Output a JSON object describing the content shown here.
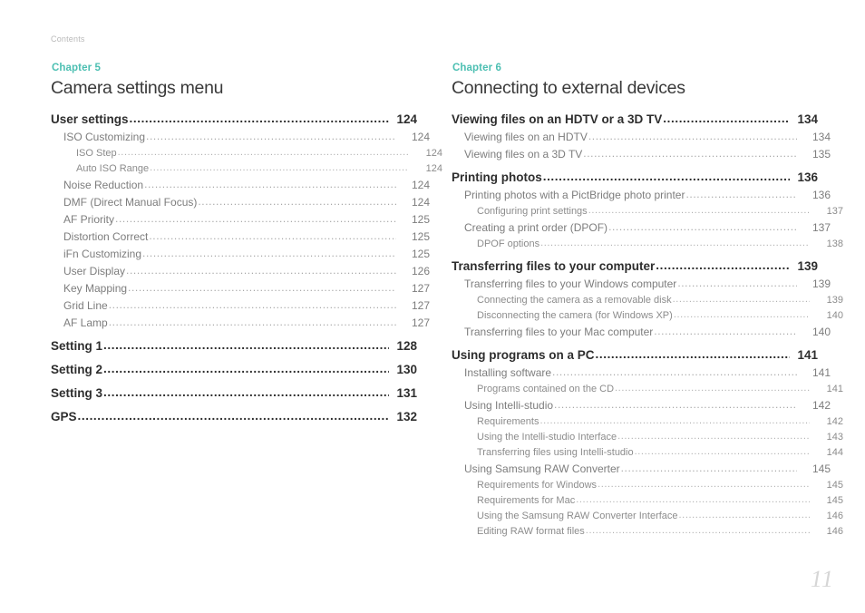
{
  "running_head": "Contents",
  "folio": "11",
  "accent_color": "#4cbfb2",
  "columns": [
    {
      "chapter_label": "Chapter 5",
      "chapter_title": "Camera settings menu",
      "entries": [
        {
          "level": 1,
          "label": "User settings",
          "page": "124"
        },
        {
          "level": 2,
          "label": "ISO Customizing",
          "page": "124"
        },
        {
          "level": 3,
          "label": "ISO Step",
          "page": "124"
        },
        {
          "level": 3,
          "label": "Auto ISO Range",
          "page": "124"
        },
        {
          "level": 2,
          "label": "Noise Reduction",
          "page": "124"
        },
        {
          "level": 2,
          "label": "DMF (Direct Manual Focus)",
          "page": "124"
        },
        {
          "level": 2,
          "label": "AF Priority",
          "page": "125"
        },
        {
          "level": 2,
          "label": "Distortion Correct",
          "page": "125"
        },
        {
          "level": 2,
          "label": "iFn Customizing",
          "page": "125"
        },
        {
          "level": 2,
          "label": "User Display",
          "page": "126"
        },
        {
          "level": 2,
          "label": "Key Mapping",
          "page": "127"
        },
        {
          "level": 2,
          "label": "Grid Line",
          "page": "127"
        },
        {
          "level": 2,
          "label": "AF Lamp",
          "page": "127"
        },
        {
          "level": 1,
          "label": "Setting 1",
          "page": "128"
        },
        {
          "level": 1,
          "label": "Setting 2",
          "page": "130"
        },
        {
          "level": 1,
          "label": "Setting 3",
          "page": "131"
        },
        {
          "level": 1,
          "label": "GPS",
          "page": "132"
        }
      ]
    },
    {
      "chapter_label": "Chapter 6",
      "chapter_title": "Connecting to external devices",
      "entries": [
        {
          "level": 1,
          "label": "Viewing files on an HDTV or a 3D TV",
          "page": "134"
        },
        {
          "level": 2,
          "label": "Viewing files on an HDTV",
          "page": "134"
        },
        {
          "level": 2,
          "label": "Viewing files on a 3D TV",
          "page": "135"
        },
        {
          "level": 1,
          "label": "Printing photos",
          "page": "136"
        },
        {
          "level": 2,
          "label": "Printing photos with a PictBridge photo printer",
          "page": "136"
        },
        {
          "level": 3,
          "label": "Configuring print settings",
          "page": "137"
        },
        {
          "level": 2,
          "label": "Creating a print order (DPOF)",
          "page": "137"
        },
        {
          "level": 3,
          "label": "DPOF options",
          "page": "138"
        },
        {
          "level": 1,
          "label": "Transferring files to your computer",
          "page": "139"
        },
        {
          "level": 2,
          "label": "Transferring files to your Windows computer",
          "page": "139"
        },
        {
          "level": 3,
          "label": "Connecting the camera as a removable disk",
          "page": "139"
        },
        {
          "level": 3,
          "label": "Disconnecting the camera (for Windows XP)",
          "page": "140"
        },
        {
          "level": 2,
          "label": "Transferring files to your Mac computer",
          "page": "140"
        },
        {
          "level": 1,
          "label": "Using programs on a PC",
          "page": "141"
        },
        {
          "level": 2,
          "label": "Installing software",
          "page": "141"
        },
        {
          "level": 3,
          "label": "Programs contained on the CD",
          "page": "141"
        },
        {
          "level": 2,
          "label": "Using Intelli-studio",
          "page": "142"
        },
        {
          "level": 3,
          "label": "Requirements",
          "page": "142"
        },
        {
          "level": 3,
          "label": "Using the Intelli-studio Interface",
          "page": "143"
        },
        {
          "level": 3,
          "label": "Transferring files using Intelli-studio",
          "page": "144"
        },
        {
          "level": 2,
          "label": "Using Samsung RAW Converter",
          "page": "145"
        },
        {
          "level": 3,
          "label": "Requirements for Windows",
          "page": "145"
        },
        {
          "level": 3,
          "label": "Requirements for Mac",
          "page": "145"
        },
        {
          "level": 3,
          "label": "Using the Samsung RAW Converter Interface",
          "page": "146"
        },
        {
          "level": 3,
          "label": "Editing RAW format files",
          "page": "146"
        }
      ]
    }
  ]
}
